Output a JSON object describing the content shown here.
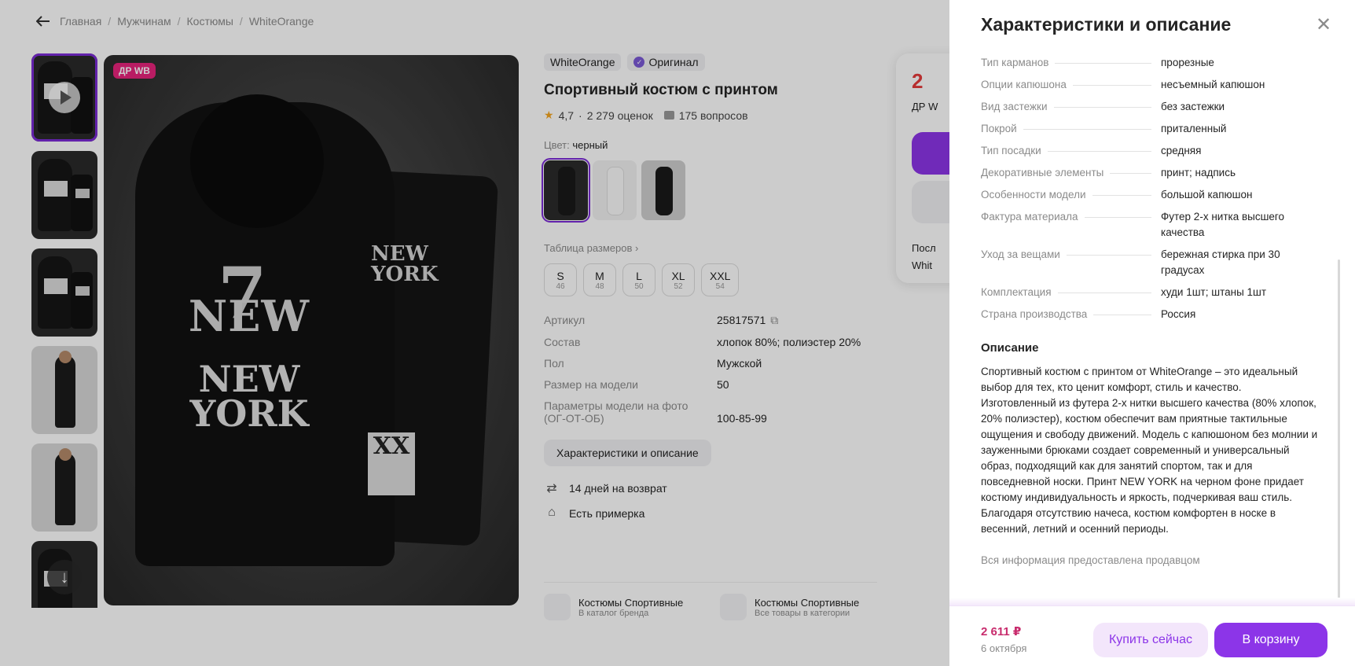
{
  "breadcrumb": [
    "Главная",
    "Мужчинам",
    "Костюмы",
    "WhiteOrange"
  ],
  "gallery": {
    "badge": "ДР WB"
  },
  "product": {
    "brand": "WhiteOrange",
    "original": "Оригинал",
    "title": "Спортивный костюм с принтом",
    "rating": "4,7",
    "reviews": "2 279 оценок",
    "questions": "175 вопросов",
    "color_label": "Цвет:",
    "color_value": "черный",
    "size_table_link": "Таблица размеров",
    "sizes": [
      {
        "size": "S",
        "ru": "46"
      },
      {
        "size": "M",
        "ru": "48"
      },
      {
        "size": "L",
        "ru": "50"
      },
      {
        "size": "XL",
        "ru": "52"
      },
      {
        "size": "XXL",
        "ru": "54"
      }
    ],
    "specs": [
      {
        "k": "Артикул",
        "v": "25817571"
      },
      {
        "k": "Состав",
        "v": "хлопок 80%; полиэстер 20%"
      },
      {
        "k": "Пол",
        "v": "Мужской"
      },
      {
        "k": "Размер на модели",
        "v": "50"
      },
      {
        "k": "Параметры модели на фото (ОГ-ОТ-ОБ)",
        "v": "100-85-99"
      }
    ],
    "characteristics_button": "Характеристики и описание",
    "return": "14 дней на возврат",
    "fitting": "Есть примерка",
    "brand_cards": [
      {
        "t1": "Костюмы Спортивные",
        "t2": "В каталог бренда"
      },
      {
        "t1": "Костюмы Спортивные",
        "t2": "Все товары в категории"
      }
    ]
  },
  "price_card": {
    "price_partial": "2",
    "dr_partial": "ДР W",
    "line1": "Посл",
    "line2": "Whit"
  },
  "drawer": {
    "title": "Характеристики и описание",
    "characteristics": [
      {
        "k": "Тип карманов",
        "v": "прорезные"
      },
      {
        "k": "Опции капюшона",
        "v": "несъемный капюшон"
      },
      {
        "k": "Вид застежки",
        "v": "без застежки"
      },
      {
        "k": "Покрой",
        "v": "приталенный"
      },
      {
        "k": "Тип посадки",
        "v": "средняя"
      },
      {
        "k": "Декоративные элементы",
        "v": "принт; надпись"
      },
      {
        "k": "Особенности модели",
        "v": "большой капюшон"
      },
      {
        "k": "Фактура материала",
        "v": "Футер 2-х нитка высшего качества"
      },
      {
        "k": "Уход за вещами",
        "v": "бережная стирка при 30 градусах"
      },
      {
        "k": "Комплектация",
        "v": "худи 1шт; штаны 1шт"
      },
      {
        "k": "Страна производства",
        "v": "Россия"
      }
    ],
    "description_title": "Описание",
    "description": "Спортивный костюм с принтом от WhiteOrange – это идеальный выбор для тех, кто ценит комфорт, стиль и качество. Изготовленный из футера 2-х нитки высшего качества (80% хлопок, 20% полиэстер), костюм обеспечит вам приятные тактильные ощущения и свободу движений. Модель с капюшоном без молнии и зауженными брюками создает современный и универсальный образ, подходящий как для занятий спортом, так и для повседневной носки. Принт NEW YORK на черном фоне придает костюму индивидуальность и яркость, подчеркивая ваш стиль. Благодаря отсутствию начеса, костюм комфортен в носке в весенний, летний и осенний периоды.",
    "note": "Вся информация предоставлена продавцом",
    "footer": {
      "price": "2 611 ₽",
      "date": "6 октября",
      "buy_now": "Купить сейчас",
      "add_to_cart": "В корзину"
    }
  },
  "colors": {
    "accent": "#8c35e8",
    "price": "#c82c6d",
    "badge": "#e8237c"
  }
}
